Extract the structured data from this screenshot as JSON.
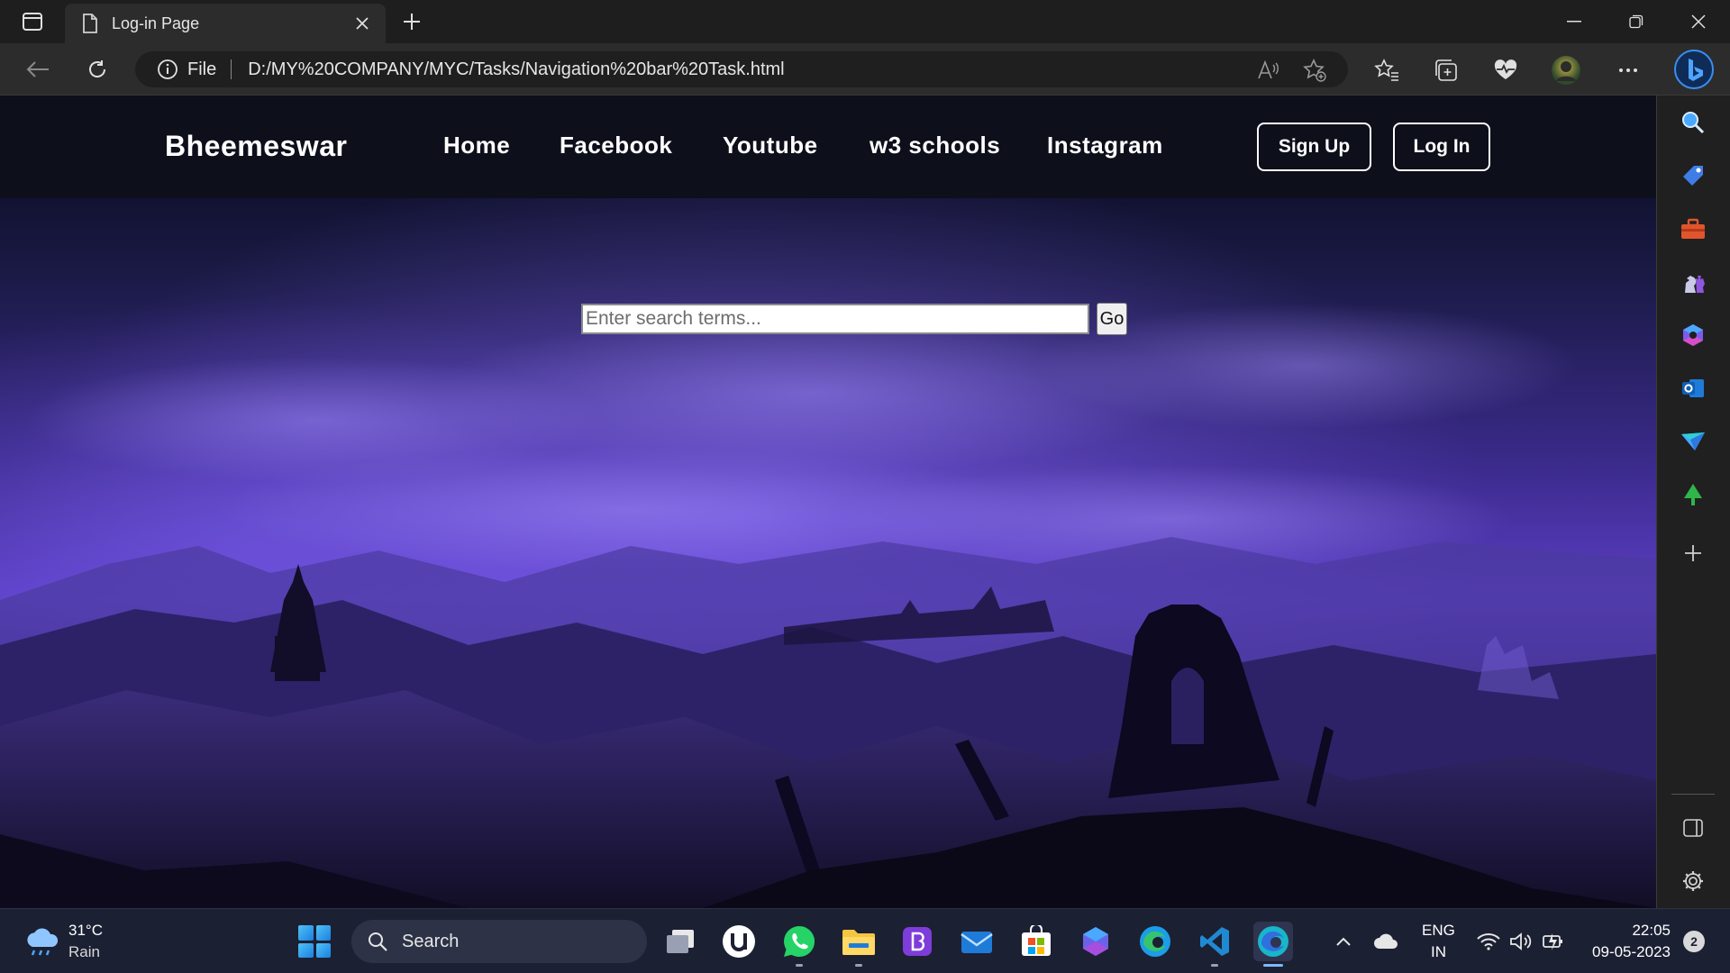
{
  "browser": {
    "tab_title": "Log-in Page",
    "address_protocol": "File",
    "address_url": "D:/MY%20COMPANY/MYC/Tasks/Navigation%20bar%20Task.html",
    "sidebar_icons": [
      "search-icon",
      "shopping-tag-icon",
      "toolbox-icon",
      "chess-games-icon",
      "microsoft-365-icon",
      "outlook-icon",
      "drop-icon",
      "tree-icon",
      "add-icon",
      "split-screen-icon",
      "settings-icon"
    ]
  },
  "site": {
    "brand": "Bheemeswar",
    "nav_links": [
      "Home",
      "Facebook",
      "Youtube",
      "w3 schools",
      "Instagram"
    ],
    "signup_label": "Sign Up",
    "login_label": "Log In",
    "search_placeholder": "Enter search terms...",
    "go_label": "Go",
    "colors": {
      "navbar_bg": "#0d0f1b",
      "sky_purple": "#5b3ec4",
      "text_white": "#ffffff"
    }
  },
  "taskbar": {
    "weather_temp": "31°C",
    "weather_desc": "Rain",
    "search_label": "Search",
    "lang_primary": "ENG",
    "lang_secondary": "IN",
    "time": "22:05",
    "date": "09-05-2023",
    "notification_count": "2",
    "apps": [
      "task-view-icon",
      "ubuntu-icon",
      "whatsapp-icon",
      "file-explorer-icon",
      "bootstrap-icon",
      "mail-icon",
      "microsoft-store-icon",
      "copilot-icon",
      "edge-icon",
      "vscode-icon",
      "edge-dev-icon"
    ]
  }
}
